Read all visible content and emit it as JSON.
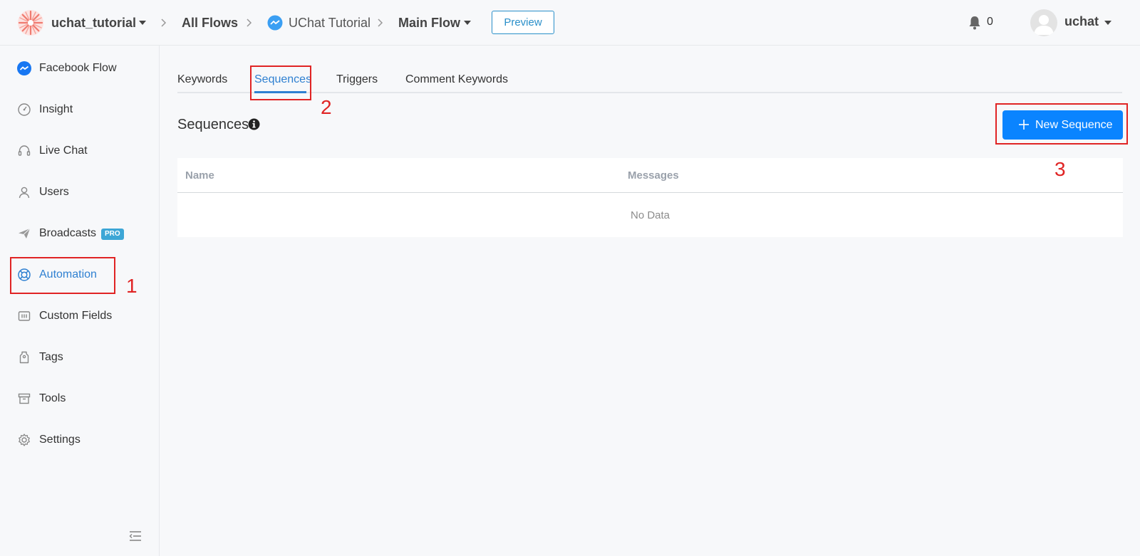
{
  "header": {
    "workspace": "uchat_tutorial",
    "breadcrumb_all_flows": "All Flows",
    "breadcrumb_bot": "UChat Tutorial",
    "breadcrumb_flow": "Main Flow",
    "preview_label": "Preview",
    "notification_count": "0",
    "user_name": "uchat"
  },
  "sidebar": {
    "items": [
      {
        "label": "Facebook Flow",
        "icon": "messenger-icon"
      },
      {
        "label": "Insight",
        "icon": "gauge-icon"
      },
      {
        "label": "Live Chat",
        "icon": "headset-icon"
      },
      {
        "label": "Users",
        "icon": "user-icon"
      },
      {
        "label": "Broadcasts",
        "icon": "paper-plane-icon",
        "badge": "PRO"
      },
      {
        "label": "Automation",
        "icon": "lifebuoy-icon",
        "active": true
      },
      {
        "label": "Custom Fields",
        "icon": "custom-fields-icon"
      },
      {
        "label": "Tags",
        "icon": "tag-icon"
      },
      {
        "label": "Tools",
        "icon": "archive-box-icon"
      },
      {
        "label": "Settings",
        "icon": "gear-icon"
      }
    ]
  },
  "main": {
    "tabs": [
      {
        "label": "Keywords"
      },
      {
        "label": "Sequences",
        "active": true
      },
      {
        "label": "Triggers"
      },
      {
        "label": "Comment Keywords"
      }
    ],
    "section_title": "Sequences",
    "new_button_label": "New Sequence",
    "table": {
      "columns": [
        "Name",
        "Messages"
      ],
      "empty_text": "No Data"
    }
  },
  "annotations": [
    "1",
    "2",
    "3"
  ],
  "colors": {
    "accent": "#2f80d1",
    "button": "#0a84ff",
    "annotation": "#e02424",
    "pro_badge": "#3da6d6"
  }
}
